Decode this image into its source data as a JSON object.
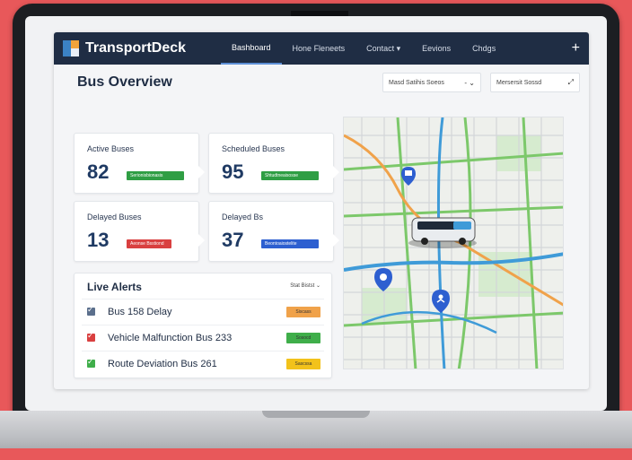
{
  "app": {
    "name": "TransportDeck"
  },
  "nav": {
    "items": [
      {
        "label": "Bashboard",
        "active": true
      },
      {
        "label": "Hone Fleneets",
        "active": false
      },
      {
        "label": "Contact ▾",
        "active": false
      },
      {
        "label": "Eevions",
        "active": false
      },
      {
        "label": "Chdgs",
        "active": false
      }
    ],
    "plus": "+"
  },
  "header": {
    "title": "Bus Overview",
    "dropdown1": "Masd Satihis Soeos",
    "dropdown2": "Mersersit Sossd"
  },
  "stats": [
    {
      "label": "Active Buses",
      "value": "82",
      "bar_text": "Serionisbionasis",
      "color": "#2f9e44"
    },
    {
      "label": "Scheduled Buses",
      "value": "95",
      "bar_text": "Shtudtneaisosse",
      "color": "#2f9e44"
    },
    {
      "label": "Delayed Buses",
      "value": "13",
      "bar_text": "Aeonse Bsstiond",
      "color": "#d94040"
    },
    {
      "label": "Delayed Bs",
      "value": "37",
      "bar_text": "Beontoaiostelite",
      "color": "#2d5fd0"
    }
  ],
  "alerts": {
    "title": "Live Alerts",
    "filter": "Stat Bistst ⌄",
    "items": [
      {
        "text": "Bus 158 Delay",
        "check_color": "#5b6f8c",
        "badge": "Siscass",
        "badge_color": "#f0a24a"
      },
      {
        "text": "Vehicle Malfunction Bus 233",
        "check_color": "#d94040",
        "badge": "Sosocd",
        "badge_color": "#3fae4a"
      },
      {
        "text": "Route Deviation Bus 261",
        "check_color": "#3fae4a",
        "badge": "Sascssa",
        "badge_color": "#f2c21b"
      }
    ]
  },
  "colors": {
    "navbar": "#1f2d44",
    "accent": "#3b82c4",
    "map_road_main": "#3f9bd8",
    "map_road_green": "#7cc86a",
    "map_road_orange": "#f0a24a"
  },
  "icons": [
    "app-logo-icon",
    "chevron-down-icon",
    "bus-marker-icon",
    "location-pin-icon",
    "person-pin-icon"
  ]
}
